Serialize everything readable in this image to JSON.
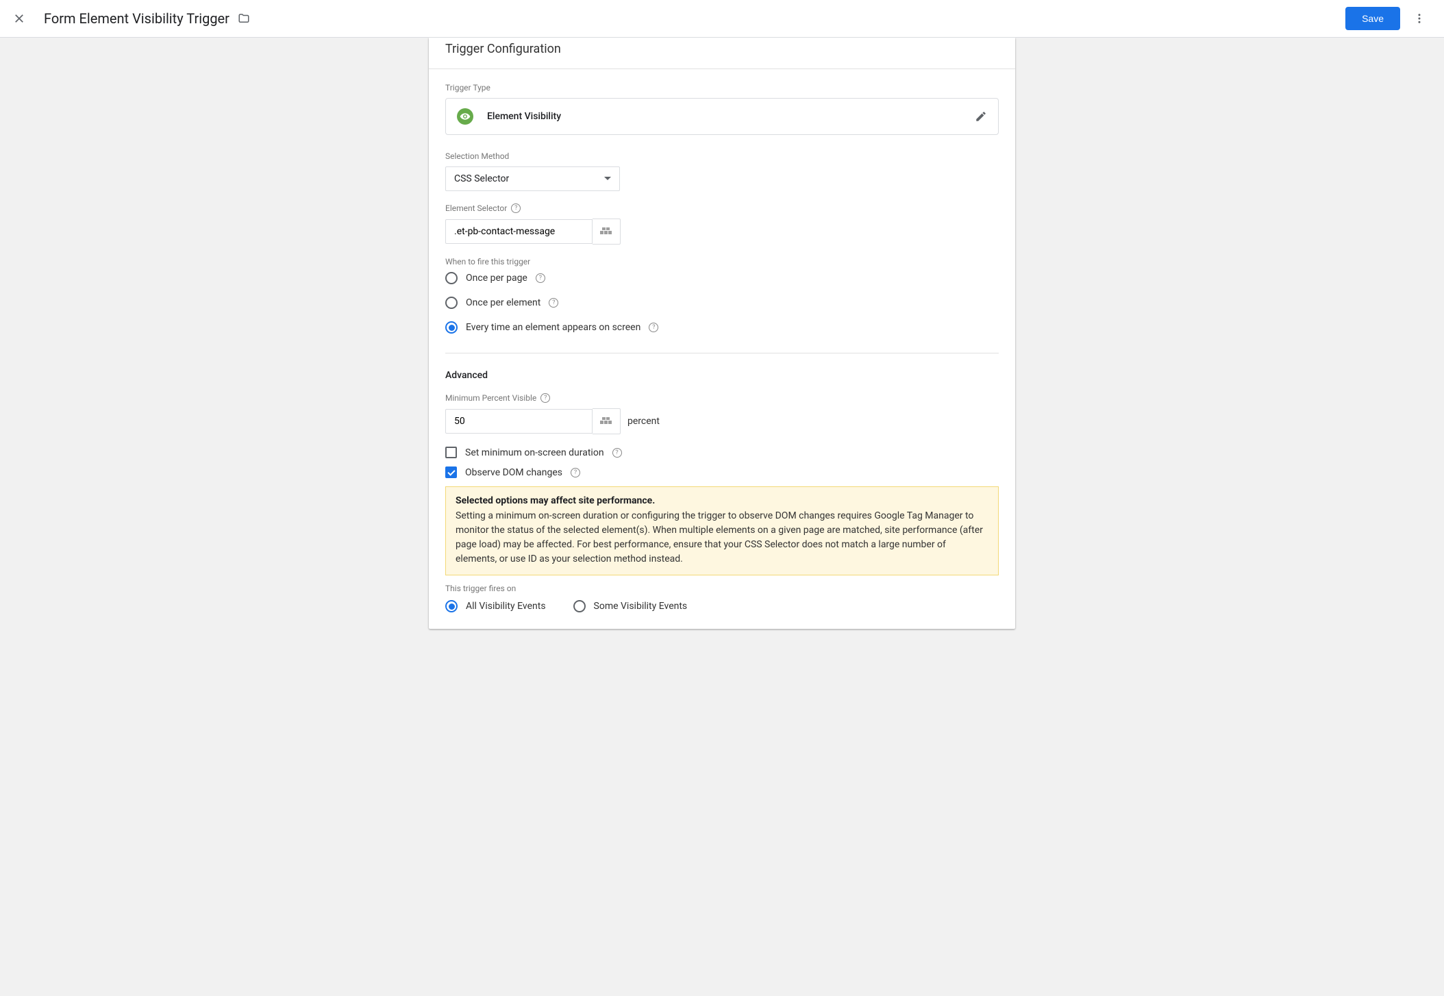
{
  "header": {
    "title": "Form Element Visibility Trigger",
    "save_label": "Save"
  },
  "card": {
    "config_title": "Trigger Configuration",
    "trigger_type_label": "Trigger Type",
    "trigger_type_name": "Element Visibility",
    "selection_method_label": "Selection Method",
    "selection_method_value": "CSS Selector",
    "element_selector_label": "Element Selector",
    "element_selector_value": ".et-pb-contact-message",
    "when_fire_label": "When to fire this trigger",
    "radio_once_page": "Once per page",
    "radio_once_element": "Once per element",
    "radio_every_time": "Every time an element appears on screen",
    "advanced_title": "Advanced",
    "min_percent_label": "Minimum Percent Visible",
    "min_percent_value": "50",
    "percent_unit": "percent",
    "checkbox_min_duration": "Set minimum on-screen duration",
    "checkbox_observe_dom": "Observe DOM changes",
    "warning_title": "Selected options may affect site performance.",
    "warning_text": "Setting a minimum on-screen duration or configuring the trigger to observe DOM changes requires Google Tag Manager to monitor the status of the selected element(s). When multiple elements on a given page are matched, site performance (after page load) may be affected. For best performance, ensure that your CSS Selector does not match a large number of elements, or use ID as your selection method instead.",
    "fires_on_label": "This trigger fires on",
    "radio_all_events": "All Visibility Events",
    "radio_some_events": "Some Visibility Events"
  }
}
